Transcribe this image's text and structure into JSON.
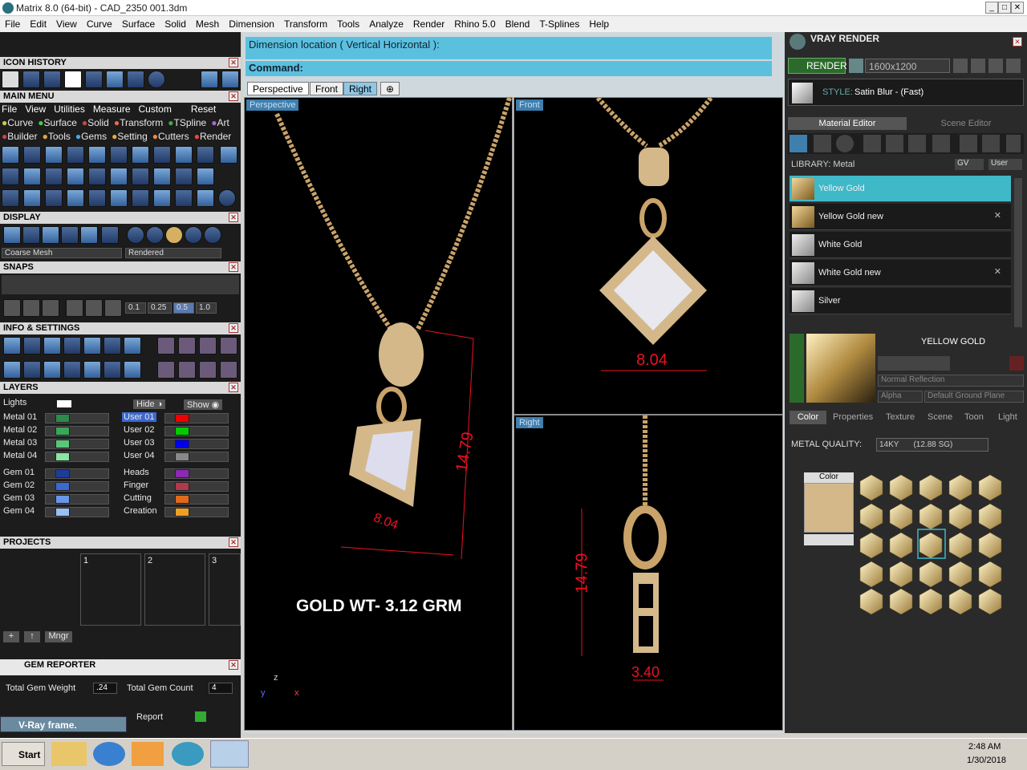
{
  "window": {
    "title": "Matrix 8.0 (64-bit) - CAD_2350 001.3dm"
  },
  "menu": [
    "File",
    "Edit",
    "View",
    "Curve",
    "Surface",
    "Solid",
    "Mesh",
    "Dimension",
    "Transform",
    "Tools",
    "Analyze",
    "Render",
    "Rhino 5.0",
    "Blend",
    "T-Splines",
    "Help"
  ],
  "left": {
    "icon_history": "ICON HISTORY",
    "main_menu": "MAIN MENU",
    "main_menu_items": [
      "File",
      "View",
      "Utilities",
      "Measure",
      "Custom",
      "Reset"
    ],
    "cats1": [
      "Curve",
      "Surface",
      "Solid",
      "Transform",
      "TSpline",
      "Art"
    ],
    "cats2": [
      "Builder",
      "Tools",
      "Gems",
      "Setting",
      "Cutters",
      "Render"
    ],
    "display": "DISPLAY",
    "display_mesh": "Coarse Mesh",
    "display_mode": "Rendered",
    "snaps": "SNAPS",
    "snap_vals": [
      "0.1",
      "0.25",
      "0.5",
      "1.0"
    ],
    "info": "INFO & SETTINGS",
    "layers": "LAYERS",
    "lights": "Lights",
    "hide": "Hide",
    "show": "Show",
    "layers_left": [
      "Metal 01",
      "Metal 02",
      "Metal 03",
      "Metal 04",
      "Gem 01",
      "Gem 02",
      "Gem 03",
      "Gem 04"
    ],
    "layers_right": [
      "User 01",
      "User 02",
      "User 03",
      "User 04",
      "Heads",
      "Finger",
      "Cutting",
      "Creation"
    ],
    "projects": "PROJECTS",
    "project_nums": [
      "1",
      "2",
      "3"
    ],
    "mngr": "Mngr",
    "gem_reporter": "GEM REPORTER",
    "total_gem_weight_label": "Total Gem Weight",
    "total_gem_weight": ".24",
    "total_gem_count_label": "Total Gem Count",
    "total_gem_count": "4",
    "report_btn": "Report",
    "vray_frame": "V-Ray frame."
  },
  "center": {
    "cmd_prompt": "Dimension location ( Vertical  Horizontal ):",
    "cmd_label": "Command:",
    "tabs": [
      "Perspective",
      "Front",
      "Right"
    ],
    "vp_persp": "Perspective",
    "vp_front": "Front",
    "vp_right": "Right",
    "gold_wt": "GOLD WT- 3.12 GRM",
    "dims": {
      "persp_h": "14.79",
      "persp_w": "8.04",
      "front_w": "8.04",
      "right_h": "14.79",
      "right_w": "3.40"
    },
    "axes": {
      "z": "z",
      "y": "y",
      "x": "x"
    }
  },
  "right": {
    "title": "VRAY RENDER",
    "render_btn": "RENDER",
    "resolution": "1600x1200",
    "style_label": "STYLE:",
    "style_value": "Satin Blur - (Fast)",
    "tab_material": "Material Editor",
    "tab_scene": "Scene Editor",
    "library": "LIBRARY: Metal",
    "gv": "GV",
    "user": "User",
    "materials": [
      "Yellow Gold",
      "Yellow Gold new",
      "White Gold",
      "White Gold new",
      "Silver"
    ],
    "selected_name": "YELLOW GOLD",
    "reflection": "Normal Reflection",
    "alpha": "Alpha",
    "ground": "Default Ground Plane",
    "subtabs": [
      "Color",
      "Properties",
      "Texture",
      "Scene",
      "Toon",
      "Light"
    ],
    "metal_quality_label": "METAL QUALITY:",
    "metal_quality": "14KY",
    "metal_sg": "(12.88 SG)",
    "color_label": "Color",
    "color_hex": "#d4b88a"
  },
  "taskbar": {
    "start": "Start",
    "time": "2:48 AM",
    "date": "1/30/2018"
  }
}
